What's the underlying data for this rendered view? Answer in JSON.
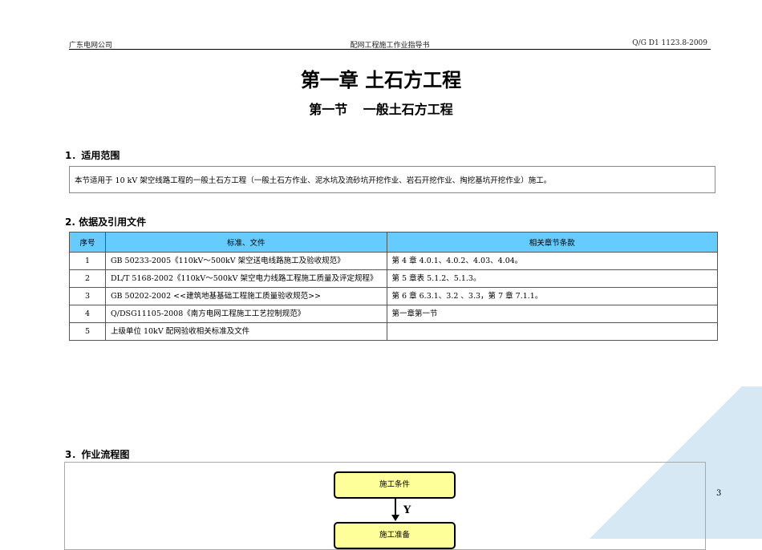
{
  "header": {
    "left": "广东电网公司",
    "center": "配网工程施工作业指导书",
    "right": "Q/G D1 1123.8-2009"
  },
  "chapter_title": "第一章 土石方工程",
  "section_title": "第一节 一般土石方工程",
  "sections": {
    "scope": {
      "heading": "1．适用范围",
      "text": "本节适用于 10 kV 架空线路工程的一般土石方工程（一般土石方作业、泥水坑及流砂坑开挖作业、岩石开挖作业、掏挖基坑开挖作业）施工。"
    },
    "references": {
      "heading": "2. 依据及引用文件",
      "columns": [
        "序号",
        "标准、文件",
        "相关章节条款"
      ],
      "rows": [
        [
          "1",
          "GB 50233-2005《110kV～500kV 架空送电线路施工及验收规范》",
          "第 4 章 4.0.1、4.0.2、4.03、4.04。"
        ],
        [
          "2",
          "DL/T 5168-2002《110kV～500kV 架空电力线路工程施工质量及评定规程》",
          "第 5 章表 5.1.2、5.1.3。"
        ],
        [
          "3",
          "GB 50202-2002 <<建筑地基基础工程施工质量验收规范>>",
          "第 6 章 6.3.1、3.2 、3.3，第 7 章 7.1.1。"
        ],
        [
          "4",
          "Q/DSG11105-2008《南方电网工程施工工艺控制规范》",
          "第一章第一节"
        ],
        [
          "5",
          "上级单位 10kV 配网验收相关标准及文件",
          ""
        ]
      ]
    },
    "flow": {
      "heading": "3．作业流程图",
      "steps": [
        "施工条件",
        "施工准备"
      ],
      "arrow_label": "Y"
    }
  },
  "page_number": "3"
}
